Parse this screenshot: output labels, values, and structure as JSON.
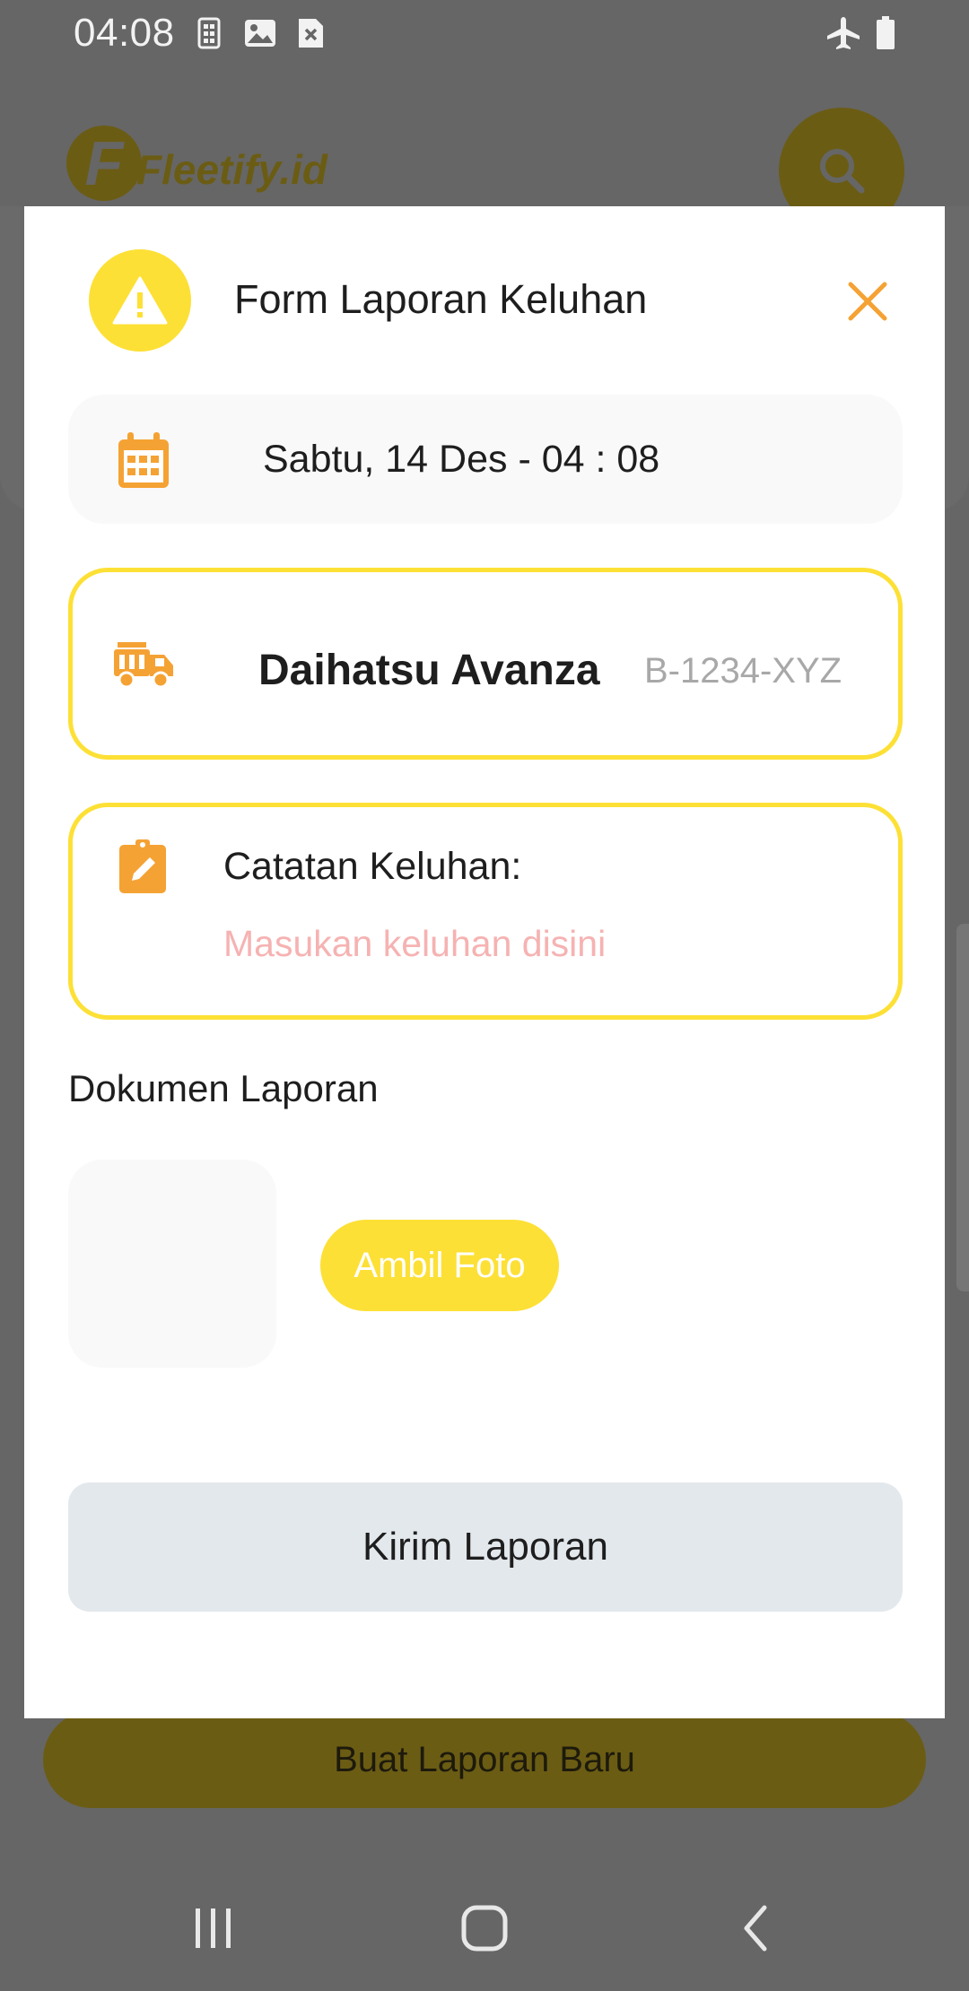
{
  "status_bar": {
    "time": "04:08",
    "left_icons": [
      "sim-icon",
      "image-icon",
      "blocked-notification-icon"
    ],
    "right_icons": [
      "airplane-mode-icon",
      "battery-icon"
    ]
  },
  "background_app": {
    "logo_text": "Fleetify.id",
    "bottom_button_label": "Buat Laporan Baru"
  },
  "modal": {
    "title": "Form Laporan Keluhan",
    "header_icon": "warning-icon",
    "close_icon": "close-icon",
    "date_time": "Sabtu, 14 Des - 04 : 08",
    "vehicle": {
      "name": "Daihatsu Avanza",
      "plate": "B-1234-XYZ"
    },
    "complaint": {
      "label": "Catatan Keluhan:",
      "placeholder": "Masukan keluhan disini",
      "value": ""
    },
    "document_label": "Dokumen Laporan",
    "take_photo_label": "Ambil Foto",
    "submit_label": "Kirim Laporan"
  },
  "colors": {
    "accent_yellow": "#fde035",
    "icon_orange": "#f5a234",
    "placeholder_pink": "#f6b2b2",
    "submit_bg": "#e3e8ec",
    "overlay": "#666666"
  }
}
